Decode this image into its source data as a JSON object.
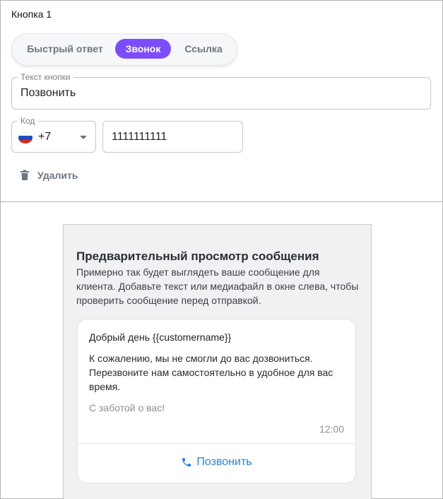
{
  "editor": {
    "button_title": "Кнопка 1",
    "segments": {
      "quick_reply": "Быстрый ответ",
      "call": "Звонок",
      "link": "Ссылка"
    },
    "button_text_field": {
      "label": "Текст кнопки",
      "value": "Позвонить"
    },
    "code_field": {
      "label": "Код",
      "value": "+7",
      "flag_icon": "russia-flag-icon"
    },
    "phone_field": {
      "value": "1111111111"
    },
    "delete_label": "Удалить"
  },
  "preview": {
    "title": "Предварительный просмотр сообщения",
    "description": "Примерно так будет выглядеть ваше сообщение для клиента. Добавьте текст или медиафайл в окне слева, чтобы проверить сообщение перед отправкой.",
    "message": {
      "greeting": "Добрый день {{customername}}",
      "body": "К сожалению, мы не смогли до вас дозвониться. Перезвоните нам самостоятельно в удобное для вас время.",
      "footer": "С заботой о вас!",
      "time": "12:00",
      "call_button_label": "Позвонить"
    }
  },
  "colors": {
    "accent": "#7b4dff",
    "link": "#2f7de1",
    "muted": "#6c7682"
  }
}
